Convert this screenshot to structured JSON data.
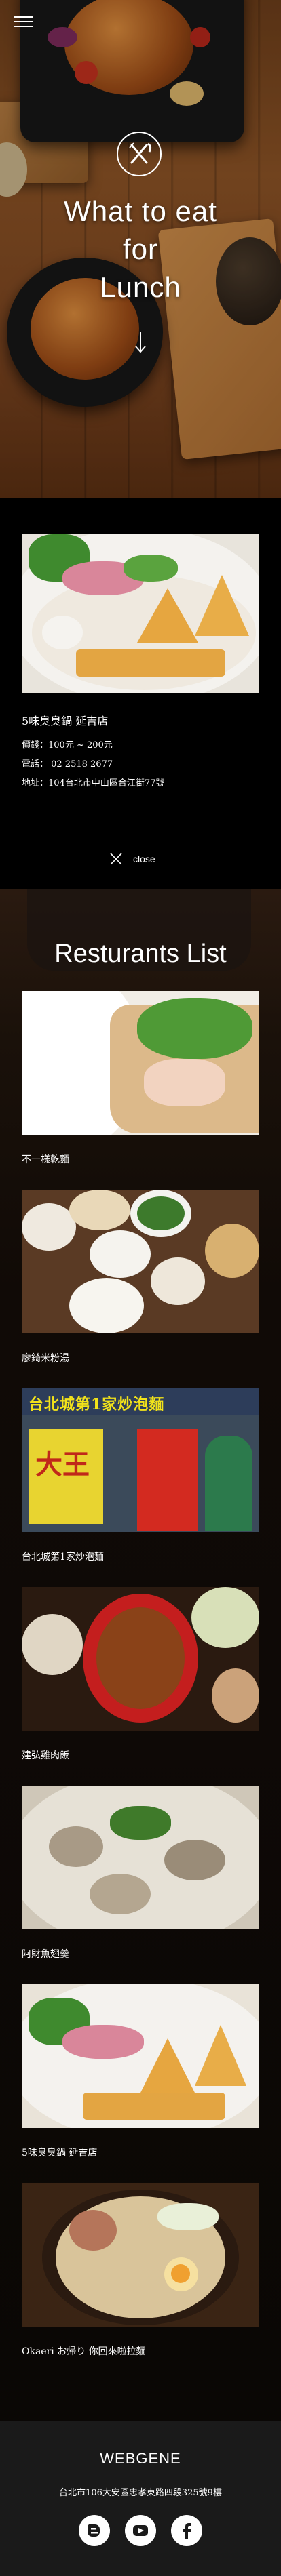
{
  "hero": {
    "title_lines": [
      "What to eat",
      "for",
      "Lunch"
    ]
  },
  "featured": {
    "name": "5味臭臭鍋 延吉店",
    "price": "價錢：100元 ~ 200元",
    "phone": "電話： 02 2518 2677",
    "address": "地址：104台北市中山區合江街77號",
    "close_label": "close"
  },
  "list": {
    "title": "Resturants List",
    "items": [
      {
        "name": "不一樣乾麵"
      },
      {
        "name": "廖錡米粉湯"
      },
      {
        "name": "台北城第1家炒泡麵"
      },
      {
        "name": "建弘雞肉飯"
      },
      {
        "name": "阿財魚翅羹"
      },
      {
        "name": "5味臭臭鍋 延吉店"
      },
      {
        "name": "Okaeri お帰り 你回來啦拉麵"
      }
    ],
    "sign_text": "台北城第1家炒泡麵",
    "sign_big": "大王"
  },
  "footer": {
    "brand": "WEBGENE",
    "address": "台北市106大安區忠孝東路四段325號9樓",
    "social": [
      "blogger-icon",
      "youtube-icon",
      "facebook-icon"
    ]
  }
}
